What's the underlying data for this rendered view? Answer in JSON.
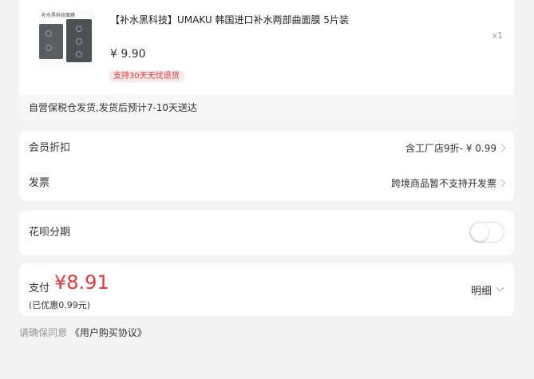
{
  "product": {
    "thumb_label": "补水黑科技面膜",
    "title": "【补水黑科技】UMAKU 韩国进口补水两部曲面膜 5片装",
    "price": "¥ 9.90",
    "return_badge": "支持30天无忧退货",
    "quantity": "x1",
    "shipping_note": "自营保税仓发货,发货后预计7-10天送达"
  },
  "discount": {
    "member_label": "会员折扣",
    "member_value": "含工厂店9折- ¥ 0.99",
    "invoice_label": "发票",
    "invoice_value": "跨境商品暂不支持开发票"
  },
  "installment": {
    "label": "花呗分期",
    "enabled": false
  },
  "payment": {
    "label": "支付",
    "amount": "¥8.91",
    "saved": "(已优惠0.99元)",
    "detail_label": "明细"
  },
  "agreement": {
    "prefix": "请确保同意",
    "link": "《用户购买协议》"
  },
  "colors": {
    "accent": "#e4393c",
    "background": "#f3f3f3"
  }
}
